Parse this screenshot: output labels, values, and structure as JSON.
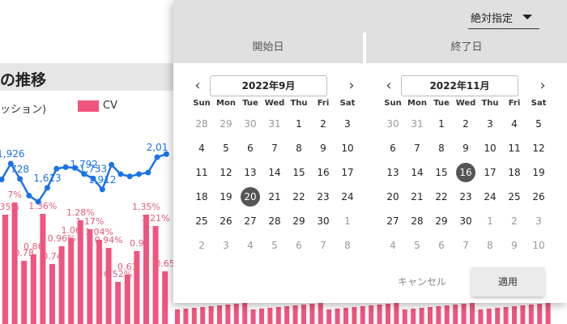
{
  "chart_panel": {
    "title": "の推移",
    "legend_left": "ッション)",
    "legend_cv": "CV",
    "colors": {
      "line": "#1a73e8",
      "bars": "#f0557e",
      "pct_text": "#e05c7c"
    }
  },
  "chart_data": {
    "type": "bar",
    "series": [
      {
        "name": "CV",
        "values": [
          1.35,
          1.5,
          0.78,
          0.86,
          1.36,
          0.74,
          0.96,
          1.06,
          1.28,
          1.17,
          1.04,
          0.94,
          0.52,
          0.61,
          0.9,
          1.35,
          1.21,
          0.65
        ]
      }
    ],
    "line_values": [
      1720,
      1926,
      1728,
      1510,
      1430,
      1613,
      1860,
      1880,
      1871,
      1792,
      1733,
      1591,
      1912,
      1790,
      1760,
      1790,
      1810,
      2010,
      2050
    ],
    "visible_line_labels": [
      "1,926",
      "728",
      "1,613",
      "1,792",
      "1,733",
      "1,912",
      "2,01"
    ],
    "visible_bar_labels": [
      "1.35%",
      "7%",
      "0.78",
      "0.86",
      "1.36%",
      "0.74",
      "0.96%",
      "1.06",
      "1.28%",
      "1.17%",
      "1.04%",
      "0.94%",
      "0.52%",
      "0.61",
      "0.9",
      "1.35%",
      "1.21%",
      "0.65"
    ]
  },
  "picker": {
    "mode_label": "絶対指定",
    "tab_start": "開始日",
    "tab_end": "終了日",
    "dow": [
      "Sun",
      "Mon",
      "Tue",
      "Wed",
      "Thu",
      "Fri",
      "Sat"
    ],
    "left": {
      "month_label": "2022年9月",
      "days": [
        [
          "28",
          "29",
          "30",
          "31",
          "1",
          "2",
          "3"
        ],
        [
          "4",
          "5",
          "6",
          "7",
          "8",
          "9",
          "10"
        ],
        [
          "11",
          "12",
          "13",
          "14",
          "15",
          "16",
          "17"
        ],
        [
          "18",
          "19",
          "20",
          "21",
          "22",
          "23",
          "24"
        ],
        [
          "25",
          "26",
          "27",
          "28",
          "29",
          "30",
          "1"
        ],
        [
          "2",
          "3",
          "4",
          "5",
          "6",
          "7",
          "8"
        ]
      ],
      "out_rows": [
        [
          0,
          0
        ],
        [
          0,
          1
        ],
        [
          0,
          2
        ],
        [
          0,
          3
        ],
        [
          4,
          6
        ],
        [
          5,
          0
        ],
        [
          5,
          1
        ],
        [
          5,
          2
        ],
        [
          5,
          3
        ],
        [
          5,
          4
        ],
        [
          5,
          5
        ],
        [
          5,
          6
        ]
      ],
      "selected": [
        3,
        2
      ]
    },
    "right": {
      "month_label": "2022年11月",
      "days": [
        [
          "30",
          "31",
          "1",
          "2",
          "3",
          "4",
          "5"
        ],
        [
          "6",
          "7",
          "8",
          "9",
          "10",
          "11",
          "12"
        ],
        [
          "13",
          "14",
          "15",
          "16",
          "17",
          "18",
          "19"
        ],
        [
          "20",
          "21",
          "22",
          "23",
          "24",
          "25",
          "26"
        ],
        [
          "27",
          "28",
          "29",
          "30",
          "1",
          "2",
          "3"
        ],
        [
          "4",
          "5",
          "6",
          "7",
          "8",
          "9",
          "10"
        ]
      ],
      "out_rows": [
        [
          0,
          0
        ],
        [
          0,
          1
        ],
        [
          4,
          4
        ],
        [
          4,
          5
        ],
        [
          4,
          6
        ],
        [
          5,
          0
        ],
        [
          5,
          1
        ],
        [
          5,
          2
        ],
        [
          5,
          3
        ],
        [
          5,
          4
        ],
        [
          5,
          5
        ],
        [
          5,
          6
        ]
      ],
      "selected": [
        2,
        3
      ]
    },
    "cancel_label": "キャンセル",
    "apply_label": "適用"
  }
}
